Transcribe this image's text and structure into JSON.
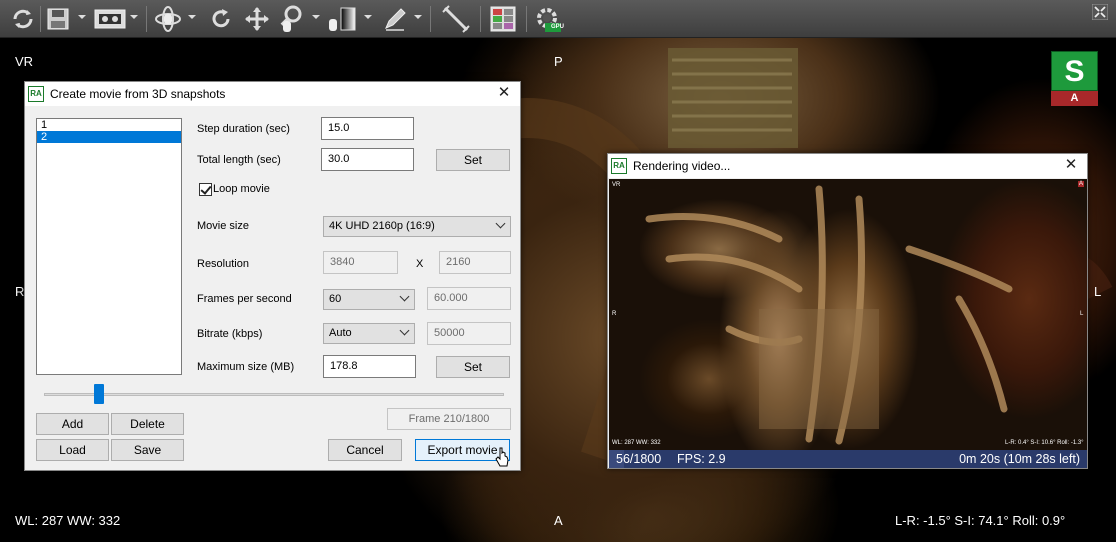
{
  "toolbar": {
    "icons": [
      "reset-icon",
      "save-icon",
      "movie-icon",
      "rotate3d-icon",
      "rotate-icon",
      "pan-icon",
      "zoom-icon",
      "windowlevel-icon",
      "draw-icon",
      "measure-icon",
      "layout-icon",
      "gpu-icon",
      "fullscreen-icon"
    ],
    "gpu_label": "GPU"
  },
  "viewport": {
    "label_top_left": "VR",
    "label_top": "P",
    "label_left": "R",
    "label_right": "L",
    "label_bottom": "A",
    "wl_ww": "WL: 287 WW: 332",
    "orientation": "L-R: -1.5° S-I: 74.1° Roll: 0.9°",
    "orient_cube_top": "S",
    "orient_cube_bottom": "A"
  },
  "movie_dialog": {
    "title": "Create movie from 3D snapshots",
    "app_icon": "RA",
    "snapshots": [
      {
        "label": "1",
        "selected": false
      },
      {
        "label": "2",
        "selected": true
      }
    ],
    "slider_position": 0.12,
    "step_duration_label": "Step duration (sec)",
    "step_duration_value": "15.0",
    "total_length_label": "Total length (sec)",
    "total_length_value": "30.0",
    "set_label": "Set",
    "loop_label": "Loop movie",
    "loop_checked": true,
    "movie_size_label": "Movie size",
    "movie_size_value": "4K UHD 2160p (16:9)",
    "resolution_label": "Resolution",
    "resolution_w": "3840",
    "resolution_x": "X",
    "resolution_h": "2160",
    "fps_label": "Frames per second",
    "fps_value": "60",
    "fps_exact": "60.000",
    "bitrate_label": "Bitrate (kbps)",
    "bitrate_value": "Auto",
    "bitrate_exact": "50000",
    "max_size_label": "Maximum size (MB)",
    "max_size_value": "178.8",
    "frame_text": "Frame 210/1800",
    "add_label": "Add",
    "delete_label": "Delete",
    "load_label": "Load",
    "save_label": "Save",
    "cancel_label": "Cancel",
    "export_label": "Export movie"
  },
  "render_dialog": {
    "title": "Rendering video...",
    "app_icon": "RA",
    "progress_fraction": 0.0311,
    "frames": "56/1800",
    "fps": "FPS: 2.9",
    "time": "0m 20s (10m 28s left)",
    "thumb_vr": "VR",
    "thumb_orient_cube": "A",
    "thumb_left": "R",
    "thumb_right": "L",
    "thumb_wl": "WL: 287 WW: 332",
    "thumb_orient": "L-R: 0.4° S-I: 10.6° Roll: -1.3°"
  }
}
